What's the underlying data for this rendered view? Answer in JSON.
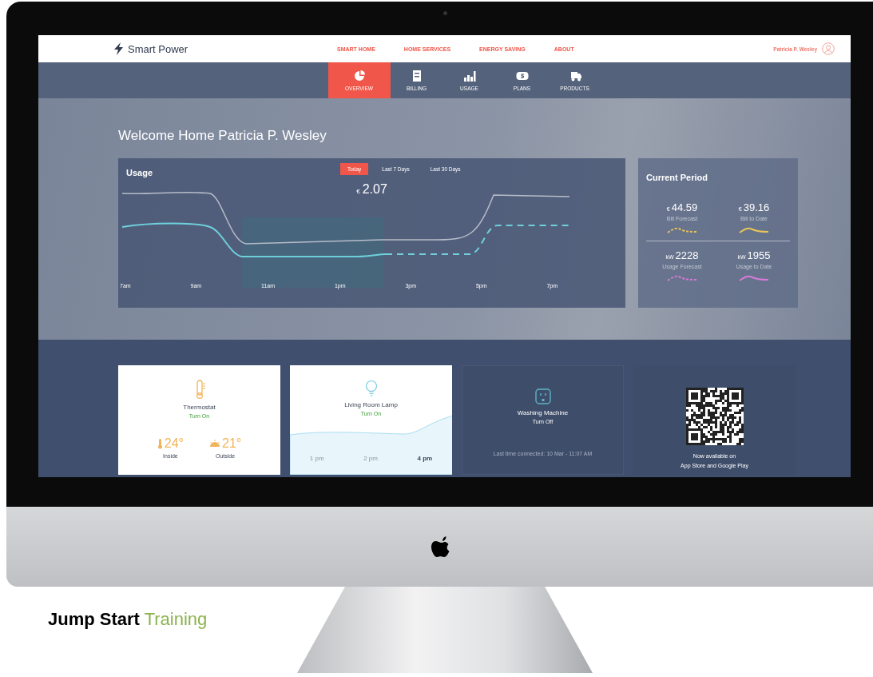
{
  "header": {
    "brand": "Smart Power",
    "menu": [
      {
        "label": "SMART HOME"
      },
      {
        "label": "HOME SERVICES"
      },
      {
        "label": "ENERGY SAVING"
      },
      {
        "label": "ABOUT"
      }
    ],
    "user": "Patricia P. Wesley"
  },
  "tabs": [
    {
      "label": "OVERVIEW",
      "selected": true
    },
    {
      "label": "BILLING",
      "selected": false
    },
    {
      "label": "USAGE",
      "selected": false
    },
    {
      "label": "PLANS",
      "selected": false
    },
    {
      "label": "PRODUCTS",
      "selected": false
    }
  ],
  "welcome": {
    "text": "Welcome Home",
    "name": "Patricia P. Wesley"
  },
  "usage": {
    "title": "Usage",
    "ranges": [
      {
        "label": "Today",
        "selected": true
      },
      {
        "label": "Last 7 Days",
        "selected": false
      },
      {
        "label": "Last 30 Days",
        "selected": false
      }
    ],
    "currency": "€",
    "amount": "2.07",
    "x_labels": [
      "7am",
      "9am",
      "11am",
      "1pm",
      "3pm",
      "5pm",
      "7pm"
    ]
  },
  "current_period": {
    "title": "Current Period",
    "stats": [
      {
        "unit": "€",
        "value": "44.59",
        "label": "Bill Forecast",
        "color": "#e8c45a",
        "dashed": true
      },
      {
        "unit": "€",
        "value": "39.16",
        "label": "Bill to Date",
        "color": "#e8c45a",
        "dashed": false
      },
      {
        "unit": "kW",
        "value": "2228",
        "label": "Usage Forecast",
        "color": "#d77ad8",
        "dashed": true
      },
      {
        "unit": "kW",
        "value": "1955",
        "label": "Usage to Date",
        "color": "#d77ad8",
        "dashed": false
      }
    ]
  },
  "devices": [
    {
      "kind": "thermostat",
      "name": "Thermostat",
      "action": "Turn On",
      "on": true,
      "readings": [
        {
          "value": "24°",
          "label": "Inside"
        },
        {
          "value": "21°",
          "label": "Outside"
        }
      ]
    },
    {
      "kind": "lamp",
      "name": "Living Room Lamp",
      "action": "Turn On",
      "on": true,
      "times": [
        {
          "label": "1 pm",
          "selected": false
        },
        {
          "label": "2 pm",
          "selected": false
        },
        {
          "label": "4 pm",
          "selected": true
        }
      ]
    },
    {
      "kind": "outlet",
      "name": "Washing Machine",
      "action": "Turn Off",
      "on": false,
      "note": "Last time connected: 10 Mar - 11:07 AM"
    },
    {
      "kind": "app",
      "lines": [
        "Now available on",
        "App Store and Google Play"
      ]
    }
  ],
  "caption": {
    "bold": "Jump Start",
    "rest": "Training"
  }
}
